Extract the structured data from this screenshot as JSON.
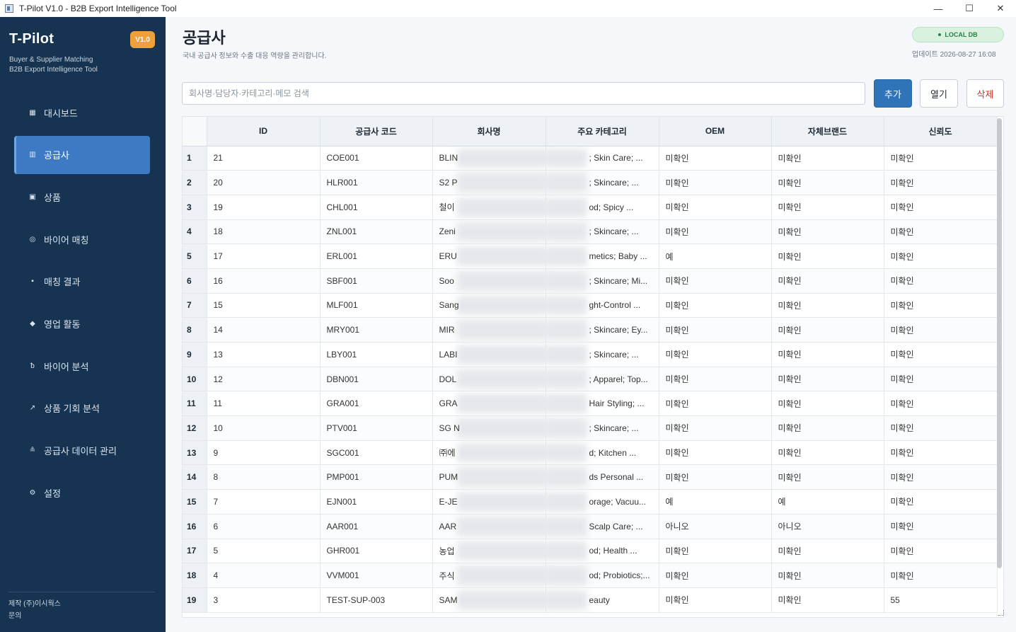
{
  "window": {
    "title": "T-Pilot V1.0 - B2B Export Intelligence Tool",
    "controls": {
      "minimize": "—",
      "maximize": "☐",
      "close": "✕"
    }
  },
  "sidebar": {
    "brand": "T-Pilot",
    "version": "V1.0",
    "tagline_1": "Buyer & Supplier Matching",
    "tagline_2": "B2B Export Intelligence Tool",
    "items": [
      {
        "label": "대시보드",
        "icon": "▦",
        "icon_name": "dashboard-icon"
      },
      {
        "label": "공급사",
        "icon": "▥",
        "icon_name": "supplier-icon",
        "active": true
      },
      {
        "label": "상품",
        "icon": "▣",
        "icon_name": "product-icon"
      },
      {
        "label": "바이어 매칭",
        "icon": "◎",
        "icon_name": "buyer-matching-icon"
      },
      {
        "label": "매칭 결과",
        "icon": "▪",
        "icon_name": "match-result-icon"
      },
      {
        "label": "영업 활동",
        "icon": "◆",
        "icon_name": "sales-activity-icon"
      },
      {
        "label": "바이어 분석",
        "icon": "ᵬ",
        "icon_name": "buyer-analysis-icon"
      },
      {
        "label": "상품 기회 분석",
        "icon": "↗",
        "icon_name": "trend-icon"
      },
      {
        "label": "공급사 데이터 관리",
        "icon": "≗",
        "icon_name": "data-management-icon"
      },
      {
        "label": "설정",
        "icon": "⚙",
        "icon_name": "gear-icon"
      }
    ],
    "footer_maker_label": "제작 (주)이시웍스",
    "footer_contact_label": "문의"
  },
  "header": {
    "title": "공급사",
    "subtitle": "국내 공급사 정보와 수출 대응 역량을 관리합니다.",
    "db_badge": "LOCAL DB",
    "updated": "업데이트 2026-08-27 16:08"
  },
  "toolbar": {
    "search_placeholder": "회사명·담당자·카테고리·메모 검색",
    "add_label": "추가",
    "open_label": "열기",
    "delete_label": "삭제"
  },
  "table": {
    "columns": [
      "ID",
      "공급사 코드",
      "회사명",
      "주요 카테고리",
      "OEM",
      "자체브랜드",
      "신뢰도"
    ],
    "rows": [
      {
        "n": "1",
        "id": "21",
        "code": "COE001",
        "company": "BLIN",
        "category": "; Skin Care; ...",
        "oem": "미확인",
        "brand": "미확인",
        "trust": "미확인"
      },
      {
        "n": "2",
        "id": "20",
        "code": "HLR001",
        "company": "S2 P",
        "category": "; Skincare; ...",
        "oem": "미확인",
        "brand": "미확인",
        "trust": "미확인"
      },
      {
        "n": "3",
        "id": "19",
        "code": "CHL001",
        "company": "철이",
        "category": "od; Spicy ...",
        "oem": "미확인",
        "brand": "미확인",
        "trust": "미확인"
      },
      {
        "n": "4",
        "id": "18",
        "code": "ZNL001",
        "company": "Zeni",
        "category": "; Skincare; ...",
        "oem": "미확인",
        "brand": "미확인",
        "trust": "미확인"
      },
      {
        "n": "5",
        "id": "17",
        "code": "ERL001",
        "company": "ERU",
        "category": "metics; Baby ...",
        "oem": "예",
        "brand": "미확인",
        "trust": "미확인"
      },
      {
        "n": "6",
        "id": "16",
        "code": "SBF001",
        "company": "Soo",
        "category": "; Skincare; Mi...",
        "oem": "미확인",
        "brand": "미확인",
        "trust": "미확인"
      },
      {
        "n": "7",
        "id": "15",
        "code": "MLF001",
        "company": "Sang",
        "category": "ght-Control ...",
        "oem": "미확인",
        "brand": "미확인",
        "trust": "미확인"
      },
      {
        "n": "8",
        "id": "14",
        "code": "MRY001",
        "company": "MIR",
        "category": "; Skincare; Ey...",
        "oem": "미확인",
        "brand": "미확인",
        "trust": "미확인"
      },
      {
        "n": "9",
        "id": "13",
        "code": "LBY001",
        "company": "LABI",
        "category": "; Skincare; ...",
        "oem": "미확인",
        "brand": "미확인",
        "trust": "미확인"
      },
      {
        "n": "10",
        "id": "12",
        "code": "DBN001",
        "company": "DOL",
        "category": "; Apparel; Top...",
        "oem": "미확인",
        "brand": "미확인",
        "trust": "미확인"
      },
      {
        "n": "11",
        "id": "11",
        "code": "GRA001",
        "company": "GRA",
        "category": " Hair Styling; ...",
        "oem": "미확인",
        "brand": "미확인",
        "trust": "미확인"
      },
      {
        "n": "12",
        "id": "10",
        "code": "PTV001",
        "company": "SG N",
        "category": "; Skincare; ...",
        "oem": "미확인",
        "brand": "미확인",
        "trust": "미확인"
      },
      {
        "n": "13",
        "id": "9",
        "code": "SGC001",
        "company": "㈜에",
        "category": "d; Kitchen ...",
        "oem": "미확인",
        "brand": "미확인",
        "trust": "미확인"
      },
      {
        "n": "14",
        "id": "8",
        "code": "PMP001",
        "company": "PUM",
        "category": "ds Personal ...",
        "oem": "미확인",
        "brand": "미확인",
        "trust": "미확인"
      },
      {
        "n": "15",
        "id": "7",
        "code": "EJN001",
        "company": "E-JE",
        "category": "orage; Vacuu...",
        "oem": "예",
        "brand": "예",
        "trust": "미확인"
      },
      {
        "n": "16",
        "id": "6",
        "code": "AAR001",
        "company": "AAR",
        "category": " Scalp Care; ...",
        "oem": "아니오",
        "brand": "아니오",
        "trust": "미확인"
      },
      {
        "n": "17",
        "id": "5",
        "code": "GHR001",
        "company": "농업",
        "category": "od; Health ...",
        "oem": "미확인",
        "brand": "미확인",
        "trust": "미확인"
      },
      {
        "n": "18",
        "id": "4",
        "code": "VVM001",
        "company": "주식",
        "category": "od; Probiotics;...",
        "oem": "미확인",
        "brand": "미확인",
        "trust": "미확인"
      },
      {
        "n": "19",
        "id": "3",
        "code": "TEST-SUP-003",
        "company": "SAM",
        "category": "eauty",
        "oem": "미확인",
        "brand": "미확인",
        "trust": "55"
      }
    ]
  }
}
